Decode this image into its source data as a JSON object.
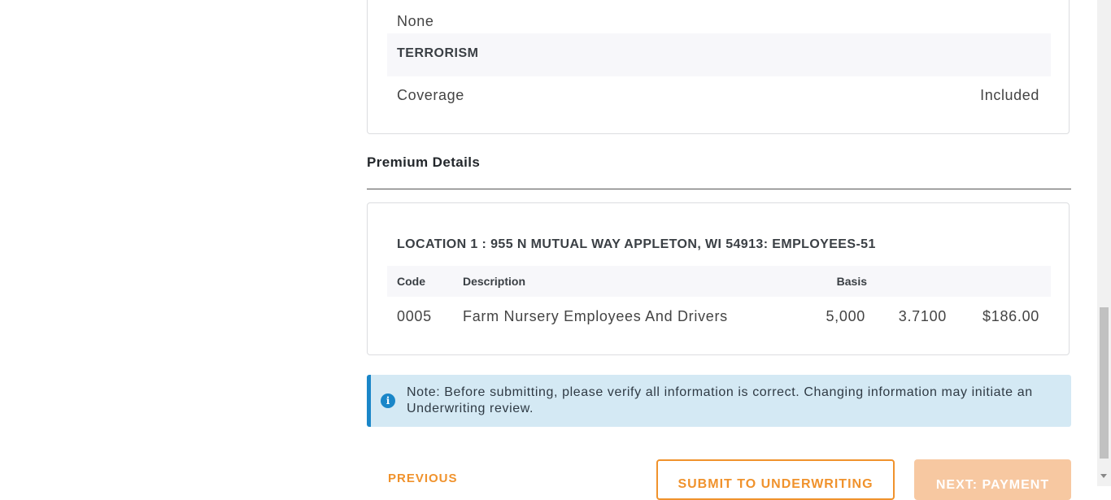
{
  "coverage_card": {
    "none_label": "None",
    "terrorism_heading": "TERRORISM",
    "coverage_label": "Coverage",
    "coverage_value": "Included"
  },
  "premium_details": {
    "title": "Premium Details",
    "location_title": "LOCATION 1 : 955 N MUTUAL WAY APPLETON, WI 54913: EMPLOYEES-51",
    "columns": [
      "Code",
      "Description",
      "Basis"
    ],
    "rows": [
      {
        "code": "0005",
        "description": "Farm Nursery Employees And Drivers",
        "basis": "5,000",
        "rate": "3.7100",
        "premium": "$186.00"
      }
    ]
  },
  "note": {
    "icon": "info-icon",
    "text": "Note: Before submitting, please verify all information is correct. Changing information may initiate an Underwriting review."
  },
  "actions": {
    "previous_label": "PREVIOUS",
    "submit_label": "SUBMIT TO UNDERWRITING",
    "next_label": "NEXT: PAYMENT"
  },
  "colors": {
    "accent": "#f0922c",
    "info": "#1a86c8",
    "info_bg": "#d4e9f4"
  }
}
